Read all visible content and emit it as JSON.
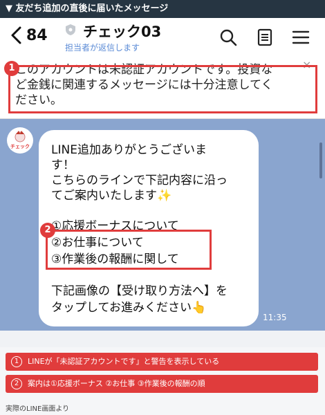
{
  "caption": "▼ 友だち追加の直後に届いたメッセージ",
  "header": {
    "back_count": "84",
    "title": "チェック03",
    "subtitle": "担当者が返信します",
    "icons": [
      "search-icon",
      "notes-icon",
      "menu-icon"
    ]
  },
  "warning": {
    "line1": "このアカウントは未認証アカウントです。投資な",
    "line2": "ど金銭に関連するメッセージには十分注意してく",
    "line3": "ださい。",
    "close": "×"
  },
  "badges": {
    "b1": "1",
    "b2": "2"
  },
  "chat": {
    "avatar_text": "チェック",
    "message_lines": [
      "LINE追加ありがとうございま",
      "す！",
      "こちらのラインで下記内容に沿っ",
      "てご案内いたします✨",
      "",
      "①応援ボーナスについて",
      "②お仕事について",
      "③作業後の報酬に関して",
      "",
      "下記画像の【受け取り方法へ】を",
      "タップしてお進みください👆"
    ],
    "time": "11:35"
  },
  "notes": [
    {
      "num": "1",
      "text": "LINEが「未認証アカウントです」と警告を表示している"
    },
    {
      "num": "2",
      "text": "案内は①応援ボーナス ②お仕事 ③作業後の報酬の順"
    }
  ],
  "footer": "実際のLINE画面より",
  "colors": {
    "accent_red": "#e03c3c",
    "chat_bg": "#8aa5cf",
    "caption_bg": "#263542"
  }
}
